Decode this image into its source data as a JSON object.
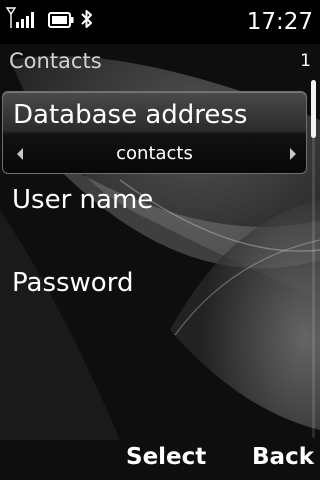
{
  "status_bar": {
    "time": "17:27",
    "icons": [
      "signal-strength-icon",
      "battery-icon",
      "bluetooth-icon"
    ]
  },
  "header": {
    "title": "Contacts",
    "counter": "1"
  },
  "fields": [
    {
      "label": "Database address",
      "value": "contacts",
      "selected": true
    },
    {
      "label": "User name",
      "value": ""
    },
    {
      "label": "Password",
      "value": ""
    }
  ],
  "softkeys": {
    "left": "",
    "middle": "Select",
    "right": "Back"
  },
  "colors": {
    "background": "#0b0b0b",
    "text": "#ffffff",
    "header_text": "#d2d2d2",
    "highlight_border": "#6f6f6f"
  }
}
